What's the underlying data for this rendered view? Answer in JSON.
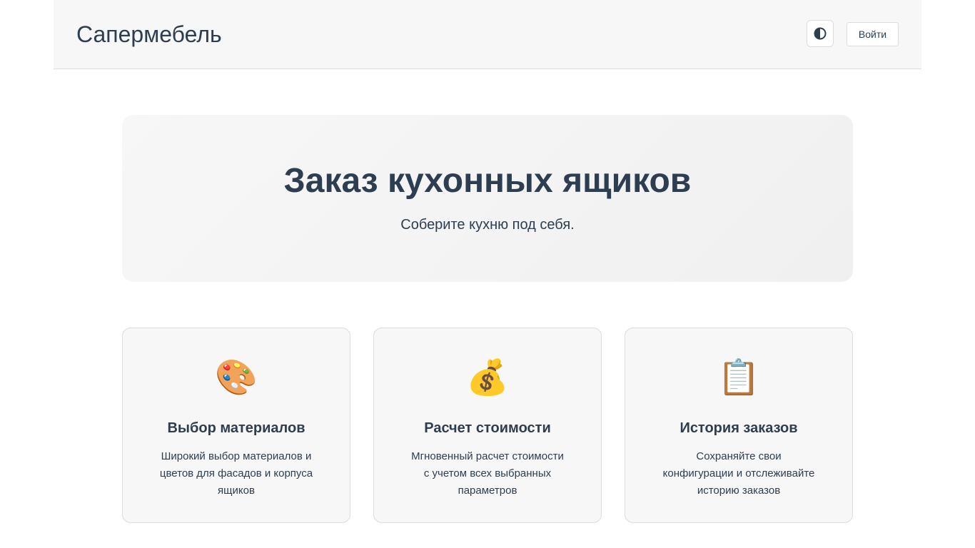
{
  "header": {
    "brand": "Сапермебель",
    "theme_toggle_icon": "half-circle-contrast-icon",
    "login_label": "Войти"
  },
  "hero": {
    "title": "Заказ кухонных ящиков",
    "subtitle": "Соберите кухню под себя."
  },
  "features": [
    {
      "icon": "🎨",
      "icon_name": "palette-icon",
      "title": "Выбор материалов",
      "text": "Широкий выбор материалов и цветов для фасадов и корпуса ящиков"
    },
    {
      "icon": "💰",
      "icon_name": "money-bag-icon",
      "title": "Расчет стоимости",
      "text": "Мгновенный расчет стоимости с учетом всех выбранных параметров"
    },
    {
      "icon": "📋",
      "icon_name": "clipboard-icon",
      "title": "История заказов",
      "text": "Сохраняйте свои конфигурации и отслеживайте историю заказов"
    }
  ],
  "colors": {
    "text": "#2c3e50",
    "surface": "#f7f7f7",
    "border": "#dcdcdc",
    "background": "#ffffff"
  }
}
